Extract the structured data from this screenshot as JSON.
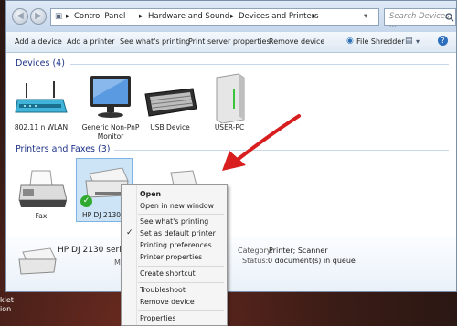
{
  "breadcrumb": {
    "items": [
      "Control Panel",
      "Hardware and Sound",
      "Devices and Printers"
    ],
    "separators": [
      "▸",
      "▸",
      "▸",
      "▸"
    ]
  },
  "search": {
    "placeholder": "Search Devices ..."
  },
  "toolbar": {
    "add_device": "Add a device",
    "add_printer": "Add a printer",
    "see_printing": "See what's printing",
    "print_server": "Print server properties",
    "remove_device": "Remove device",
    "file_shredder": "File Shredder"
  },
  "devices_section": {
    "title": "Devices (4)",
    "items": [
      {
        "label": "802.11 n WLAN"
      },
      {
        "label": "Generic Non-PnP Monitor"
      },
      {
        "label": "USB Device"
      },
      {
        "label": "USER-PC"
      }
    ]
  },
  "printers_section": {
    "title": "Printers and Faxes (3)",
    "items": [
      {
        "label": "Fax"
      },
      {
        "label": "HP DJ 2130 series"
      }
    ]
  },
  "details": {
    "name": "HP DJ 2130 series",
    "model_prefix": "M",
    "category_label": "Category:",
    "category_value": "Printer; Scanner",
    "status_label": "Status:",
    "status_value": "0 document(s) in queue"
  },
  "context_menu": {
    "items": [
      {
        "label": "Open"
      },
      {
        "label": "Open in new window"
      },
      {
        "label": "See what's printing"
      },
      {
        "label": "Set as default printer",
        "checked": true
      },
      {
        "label": "Printing preferences"
      },
      {
        "label": "Printer properties"
      },
      {
        "label": "Create shortcut"
      },
      {
        "label": "Troubleshoot"
      },
      {
        "label": "Remove device"
      },
      {
        "label": "Properties"
      }
    ],
    "check_mark": "✓"
  },
  "desktop_text": "klet\nion",
  "colors": {
    "accent_arrow": "#d81e1e",
    "section_title": "#1e3287",
    "selection": "#cde4f7"
  }
}
